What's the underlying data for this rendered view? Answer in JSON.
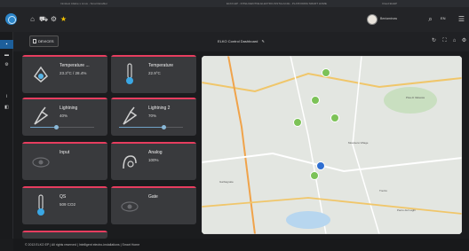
{
  "browser": {
    "tabs": [
      {
        "label": "Inimitesi zdalne s Linux - Smart Enabler"
      },
      {
        "label": "ELKO-EP - INTELIGENTNE ELEKTRO-INSTALACJE - PLATFORMA SMART HOME"
      },
      {
        "label": "Cloud EloEP"
      }
    ]
  },
  "topbar": {
    "user_name": "Beniaminow",
    "language": "EN"
  },
  "header": {
    "devices_label": "DEVICES",
    "dashboard_title": "ELKO Control Dashboard"
  },
  "tiles": [
    {
      "title": "Temperature ...",
      "value": "23.3°C / 28.4%",
      "icon": "thermostat-icon"
    },
    {
      "title": "Temperature",
      "value": "22.9°C",
      "icon": "thermometer-icon"
    },
    {
      "title": "Lightning",
      "value": "40%",
      "icon": "lamp-icon",
      "level": 0.4
    },
    {
      "title": "Lightning 2",
      "value": "70%",
      "icon": "lamp-icon",
      "level": 0.7
    },
    {
      "title": "Input",
      "value": "",
      "icon": "eye-icon"
    },
    {
      "title": "Analog",
      "value": "100%",
      "icon": "gauge-icon"
    },
    {
      "title": "QS",
      "value": "509 CO2",
      "icon": "thermometer-icon"
    },
    {
      "title": "Gate",
      "value": "",
      "icon": "eye-icon"
    }
  ],
  "map": {
    "places": [
      "Pisa di Valsesia",
      "Moarsera Village",
      "Parco dei Laghi",
      "Garbagnate",
      "Trezzo"
    ]
  },
  "footer": {
    "text": "© 2013 ELKO EP | All rights reserved | Intelligent electro-installations | Smart Home"
  },
  "colors": {
    "accent": "#e73d5f",
    "active": "#1d5f9b",
    "tile_bg": "#393a3d",
    "pin": "#7cc257"
  }
}
